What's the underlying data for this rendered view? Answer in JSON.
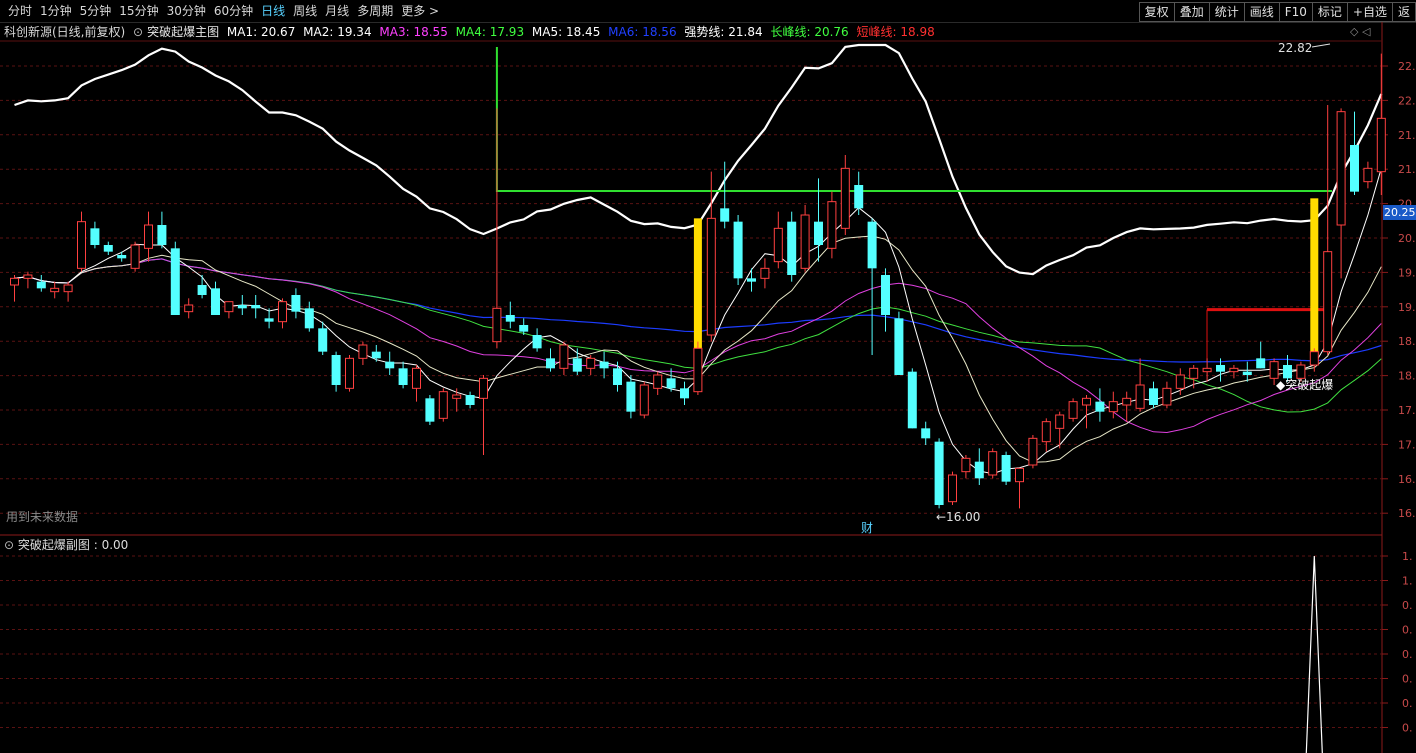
{
  "toolbar": {
    "periods": [
      "分时",
      "1分钟",
      "5分钟",
      "15分钟",
      "30分钟",
      "60分钟",
      "日线",
      "周线",
      "月线",
      "多周期",
      "更多 >"
    ],
    "active_period": "日线",
    "buttons": [
      "复权",
      "叠加",
      "统计",
      "画线",
      "F10",
      "标记",
      "+自选",
      "返"
    ]
  },
  "indicator_bar": {
    "stock": "科创新源(日线,前复权)",
    "main_chart": "突破起爆主图",
    "items": [
      {
        "label": "MA1: 20.67",
        "color": "#ffffff"
      },
      {
        "label": "MA2: 19.34",
        "color": "#ffffff"
      },
      {
        "label": "MA3: 18.55",
        "color": "#ff40ff"
      },
      {
        "label": "MA4: 17.93",
        "color": "#40ff40"
      },
      {
        "label": "MA5: 18.45",
        "color": "#ffffff"
      },
      {
        "label": "MA6: 18.56",
        "color": "#2040ff"
      },
      {
        "label": "强势线: 21.84",
        "color": "#ffffff"
      },
      {
        "label": "长峰线: 20.76",
        "color": "#40ff40"
      },
      {
        "label": "短峰线: 18.98",
        "color": "#ff3030"
      }
    ]
  },
  "annotations": {
    "high_label": "22.82",
    "low_label": "16.00",
    "signal_label": "◆突破起爆",
    "finance_marker": "财",
    "future_data": "用到未来数据"
  },
  "current_price_tag": "20.25",
  "y_axis_main": [
    "22.",
    "22.",
    "21.",
    "21.",
    "20.",
    "20.",
    "19.",
    "19.",
    "18.",
    "18.",
    "17.",
    "17.",
    "16.",
    "16."
  ],
  "sub_chart": {
    "title": "突破起爆副图 : 0.00",
    "y_axis": [
      "1.",
      "1.",
      "0.",
      "0.",
      "0.",
      "0.",
      "0.",
      "0."
    ]
  },
  "chart_data": {
    "type": "candlestick",
    "candles": [
      {
        "o": 19.35,
        "h": 19.5,
        "l": 19.1,
        "c": 19.45
      },
      {
        "o": 19.45,
        "h": 19.55,
        "l": 19.3,
        "c": 19.5
      },
      {
        "o": 19.4,
        "h": 19.5,
        "l": 19.25,
        "c": 19.3
      },
      {
        "o": 19.25,
        "h": 19.4,
        "l": 19.15,
        "c": 19.3
      },
      {
        "o": 19.25,
        "h": 19.4,
        "l": 19.1,
        "c": 19.35
      },
      {
        "o": 19.6,
        "h": 20.45,
        "l": 19.55,
        "c": 20.3
      },
      {
        "o": 20.2,
        "h": 20.3,
        "l": 19.9,
        "c": 19.95
      },
      {
        "o": 19.95,
        "h": 20.0,
        "l": 19.8,
        "c": 19.85
      },
      {
        "o": 19.8,
        "h": 19.85,
        "l": 19.7,
        "c": 19.75
      },
      {
        "o": 19.6,
        "h": 20.0,
        "l": 19.55,
        "c": 19.95
      },
      {
        "o": 19.9,
        "h": 20.45,
        "l": 19.7,
        "c": 20.25
      },
      {
        "o": 20.25,
        "h": 20.45,
        "l": 19.9,
        "c": 19.95
      },
      {
        "o": 19.9,
        "h": 20.0,
        "l": 18.9,
        "c": 18.9
      },
      {
        "o": 18.95,
        "h": 19.15,
        "l": 18.85,
        "c": 19.05
      },
      {
        "o": 19.35,
        "h": 19.5,
        "l": 19.15,
        "c": 19.2
      },
      {
        "o": 19.3,
        "h": 19.4,
        "l": 18.9,
        "c": 18.9
      },
      {
        "o": 18.95,
        "h": 19.1,
        "l": 18.85,
        "c": 19.1
      },
      {
        "o": 19.05,
        "h": 19.2,
        "l": 18.9,
        "c": 19.0
      },
      {
        "o": 19.05,
        "h": 19.2,
        "l": 18.85,
        "c": 19.0
      },
      {
        "o": 18.85,
        "h": 19.0,
        "l": 18.7,
        "c": 18.8
      },
      {
        "o": 18.8,
        "h": 19.15,
        "l": 18.7,
        "c": 19.1
      },
      {
        "o": 19.2,
        "h": 19.3,
        "l": 18.85,
        "c": 18.95
      },
      {
        "o": 19.0,
        "h": 19.1,
        "l": 18.65,
        "c": 18.7
      },
      {
        "o": 18.7,
        "h": 18.8,
        "l": 18.3,
        "c": 18.35
      },
      {
        "o": 18.3,
        "h": 18.35,
        "l": 17.75,
        "c": 17.85
      },
      {
        "o": 17.8,
        "h": 18.3,
        "l": 17.75,
        "c": 18.25
      },
      {
        "o": 18.25,
        "h": 18.5,
        "l": 18.15,
        "c": 18.45
      },
      {
        "o": 18.35,
        "h": 18.45,
        "l": 18.2,
        "c": 18.25
      },
      {
        "o": 18.2,
        "h": 18.35,
        "l": 18.0,
        "c": 18.1
      },
      {
        "o": 18.1,
        "h": 18.2,
        "l": 17.8,
        "c": 17.85
      },
      {
        "o": 17.8,
        "h": 18.15,
        "l": 17.6,
        "c": 18.1
      },
      {
        "o": 17.65,
        "h": 17.7,
        "l": 17.25,
        "c": 17.3
      },
      {
        "o": 17.35,
        "h": 17.8,
        "l": 17.3,
        "c": 17.75
      },
      {
        "o": 17.65,
        "h": 17.8,
        "l": 17.45,
        "c": 17.7
      },
      {
        "o": 17.7,
        "h": 17.75,
        "l": 17.5,
        "c": 17.55
      },
      {
        "o": 17.65,
        "h": 18.0,
        "l": 16.8,
        "c": 17.95
      },
      {
        "o": 18.5,
        "h": 22.0,
        "l": 18.4,
        "c": 19.0
      },
      {
        "o": 18.9,
        "h": 19.1,
        "l": 18.7,
        "c": 18.8
      },
      {
        "o": 18.75,
        "h": 18.85,
        "l": 18.6,
        "c": 18.65
      },
      {
        "o": 18.6,
        "h": 18.7,
        "l": 18.35,
        "c": 18.4
      },
      {
        "o": 18.25,
        "h": 18.4,
        "l": 18.05,
        "c": 18.1
      },
      {
        "o": 18.1,
        "h": 18.5,
        "l": 18.0,
        "c": 18.45
      },
      {
        "o": 18.25,
        "h": 18.4,
        "l": 18.0,
        "c": 18.05
      },
      {
        "o": 18.1,
        "h": 18.3,
        "l": 18.0,
        "c": 18.25
      },
      {
        "o": 18.2,
        "h": 18.35,
        "l": 17.95,
        "c": 18.1
      },
      {
        "o": 18.1,
        "h": 18.2,
        "l": 17.75,
        "c": 17.85
      },
      {
        "o": 17.9,
        "h": 18.0,
        "l": 17.35,
        "c": 17.45
      },
      {
        "o": 17.4,
        "h": 17.9,
        "l": 17.35,
        "c": 17.85
      },
      {
        "o": 17.8,
        "h": 18.05,
        "l": 17.7,
        "c": 18.0
      },
      {
        "o": 17.95,
        "h": 18.1,
        "l": 17.75,
        "c": 17.8
      },
      {
        "o": 17.8,
        "h": 17.9,
        "l": 17.55,
        "c": 17.65
      },
      {
        "o": 17.75,
        "h": 18.5,
        "l": 17.7,
        "c": 18.4
      },
      {
        "o": 18.6,
        "h": 21.05,
        "l": 18.5,
        "c": 20.35
      },
      {
        "o": 20.5,
        "h": 21.2,
        "l": 20.2,
        "c": 20.3
      },
      {
        "o": 20.3,
        "h": 20.4,
        "l": 19.35,
        "c": 19.45
      },
      {
        "o": 19.45,
        "h": 19.6,
        "l": 19.25,
        "c": 19.4
      },
      {
        "o": 19.45,
        "h": 19.75,
        "l": 19.3,
        "c": 19.6
      },
      {
        "o": 19.7,
        "h": 20.45,
        "l": 19.6,
        "c": 20.2
      },
      {
        "o": 20.3,
        "h": 20.45,
        "l": 19.4,
        "c": 19.5
      },
      {
        "o": 19.6,
        "h": 20.55,
        "l": 19.55,
        "c": 20.4
      },
      {
        "o": 20.3,
        "h": 20.95,
        "l": 19.7,
        "c": 19.95
      },
      {
        "o": 19.9,
        "h": 20.75,
        "l": 19.75,
        "c": 20.6
      },
      {
        "o": 20.2,
        "h": 21.3,
        "l": 20.1,
        "c": 21.1
      },
      {
        "o": 20.85,
        "h": 21.05,
        "l": 20.4,
        "c": 20.5
      },
      {
        "o": 20.3,
        "h": 20.35,
        "l": 18.3,
        "c": 19.6
      },
      {
        "o": 19.5,
        "h": 19.6,
        "l": 18.65,
        "c": 18.9
      },
      {
        "o": 18.85,
        "h": 18.95,
        "l": 18.0,
        "c": 18.0
      },
      {
        "o": 18.05,
        "h": 18.1,
        "l": 17.2,
        "c": 17.2
      },
      {
        "o": 17.2,
        "h": 17.3,
        "l": 16.95,
        "c": 17.05
      },
      {
        "o": 17.0,
        "h": 17.05,
        "l": 16.0,
        "c": 16.05
      },
      {
        "o": 16.1,
        "h": 16.55,
        "l": 16.05,
        "c": 16.5
      },
      {
        "o": 16.55,
        "h": 16.8,
        "l": 16.45,
        "c": 16.75
      },
      {
        "o": 16.7,
        "h": 16.9,
        "l": 16.35,
        "c": 16.45
      },
      {
        "o": 16.5,
        "h": 16.9,
        "l": 16.45,
        "c": 16.85
      },
      {
        "o": 16.8,
        "h": 16.85,
        "l": 16.35,
        "c": 16.4
      },
      {
        "o": 16.4,
        "h": 16.6,
        "l": 16.0,
        "c": 16.6
      },
      {
        "o": 16.65,
        "h": 17.1,
        "l": 16.6,
        "c": 17.05
      },
      {
        "o": 17.0,
        "h": 17.35,
        "l": 16.85,
        "c": 17.3
      },
      {
        "o": 17.2,
        "h": 17.45,
        "l": 16.9,
        "c": 17.4
      },
      {
        "o": 17.35,
        "h": 17.65,
        "l": 17.3,
        "c": 17.6
      },
      {
        "o": 17.55,
        "h": 17.7,
        "l": 17.2,
        "c": 17.65
      },
      {
        "o": 17.6,
        "h": 17.8,
        "l": 17.3,
        "c": 17.45
      },
      {
        "o": 17.45,
        "h": 17.75,
        "l": 17.35,
        "c": 17.6
      },
      {
        "o": 17.55,
        "h": 17.75,
        "l": 17.3,
        "c": 17.65
      },
      {
        "o": 17.5,
        "h": 18.25,
        "l": 17.45,
        "c": 17.85
      },
      {
        "o": 17.8,
        "h": 17.9,
        "l": 17.5,
        "c": 17.55
      },
      {
        "o": 17.55,
        "h": 17.9,
        "l": 17.5,
        "c": 17.8
      },
      {
        "o": 17.8,
        "h": 18.1,
        "l": 17.7,
        "c": 18.0
      },
      {
        "o": 17.95,
        "h": 18.15,
        "l": 17.8,
        "c": 18.1
      },
      {
        "o": 18.05,
        "h": 18.25,
        "l": 17.9,
        "c": 18.1
      },
      {
        "o": 18.15,
        "h": 18.25,
        "l": 17.9,
        "c": 18.05
      },
      {
        "o": 18.05,
        "h": 18.15,
        "l": 17.95,
        "c": 18.1
      },
      {
        "o": 18.05,
        "h": 18.2,
        "l": 17.9,
        "c": 18.0
      },
      {
        "o": 18.25,
        "h": 18.5,
        "l": 18.1,
        "c": 18.1
      },
      {
        "o": 17.95,
        "h": 18.25,
        "l": 17.85,
        "c": 18.2
      },
      {
        "o": 18.15,
        "h": 18.3,
        "l": 17.9,
        "c": 17.95
      },
      {
        "o": 17.95,
        "h": 18.2,
        "l": 17.9,
        "c": 18.15
      },
      {
        "o": 18.15,
        "h": 18.4,
        "l": 18.05,
        "c": 18.35
      },
      {
        "o": 18.35,
        "h": 22.05,
        "l": 18.3,
        "c": 19.85
      },
      {
        "o": 20.25,
        "h": 22.0,
        "l": 19.45,
        "c": 21.95
      },
      {
        "o": 21.45,
        "h": 21.95,
        "l": 20.7,
        "c": 20.75
      },
      {
        "o": 20.9,
        "h": 21.2,
        "l": 20.8,
        "c": 21.1
      },
      {
        "o": 21.05,
        "h": 22.82,
        "l": 20.7,
        "c": 21.85
      }
    ],
    "y_range": [
      16.0,
      22.82
    ],
    "signal_bars": [
      {
        "index": 51,
        "top": 20.35,
        "bottom": 18.35
      },
      {
        "index": 97,
        "top": 20.65,
        "bottom": 18.35
      }
    ],
    "long_peak_line": {
      "value": 20.76
    },
    "short_peak_line": {
      "value": 18.98
    },
    "sub_chart_peak": {
      "index": 97,
      "value": 1.0
    }
  }
}
